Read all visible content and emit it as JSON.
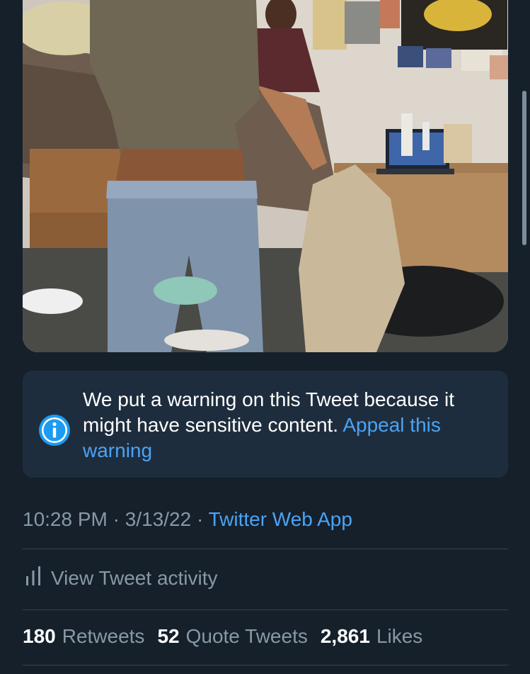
{
  "tweet": {
    "media": {
      "description_icon": "photo"
    },
    "notice": {
      "icon": "info-icon",
      "text": "We put a warning on this Tweet because it might have sensitive content.",
      "link": "Appeal this warning"
    },
    "meta": {
      "time": "10:28 PM",
      "separator": "·",
      "date": "3/13/22",
      "source": "Twitter Web App"
    },
    "activity": {
      "icon": "bar-chart-icon",
      "label": "View Tweet activity"
    },
    "stats": {
      "retweets_count": "180",
      "retweets_label": "Retweets",
      "quotes_count": "52",
      "quotes_label": "Quote Tweets",
      "likes_count": "2,861",
      "likes_label": "Likes"
    }
  },
  "colors": {
    "background": "#15202b",
    "card": "#1e2d3d",
    "link": "#4ba3f5",
    "muted": "#8899a6",
    "divider": "#38444d"
  }
}
